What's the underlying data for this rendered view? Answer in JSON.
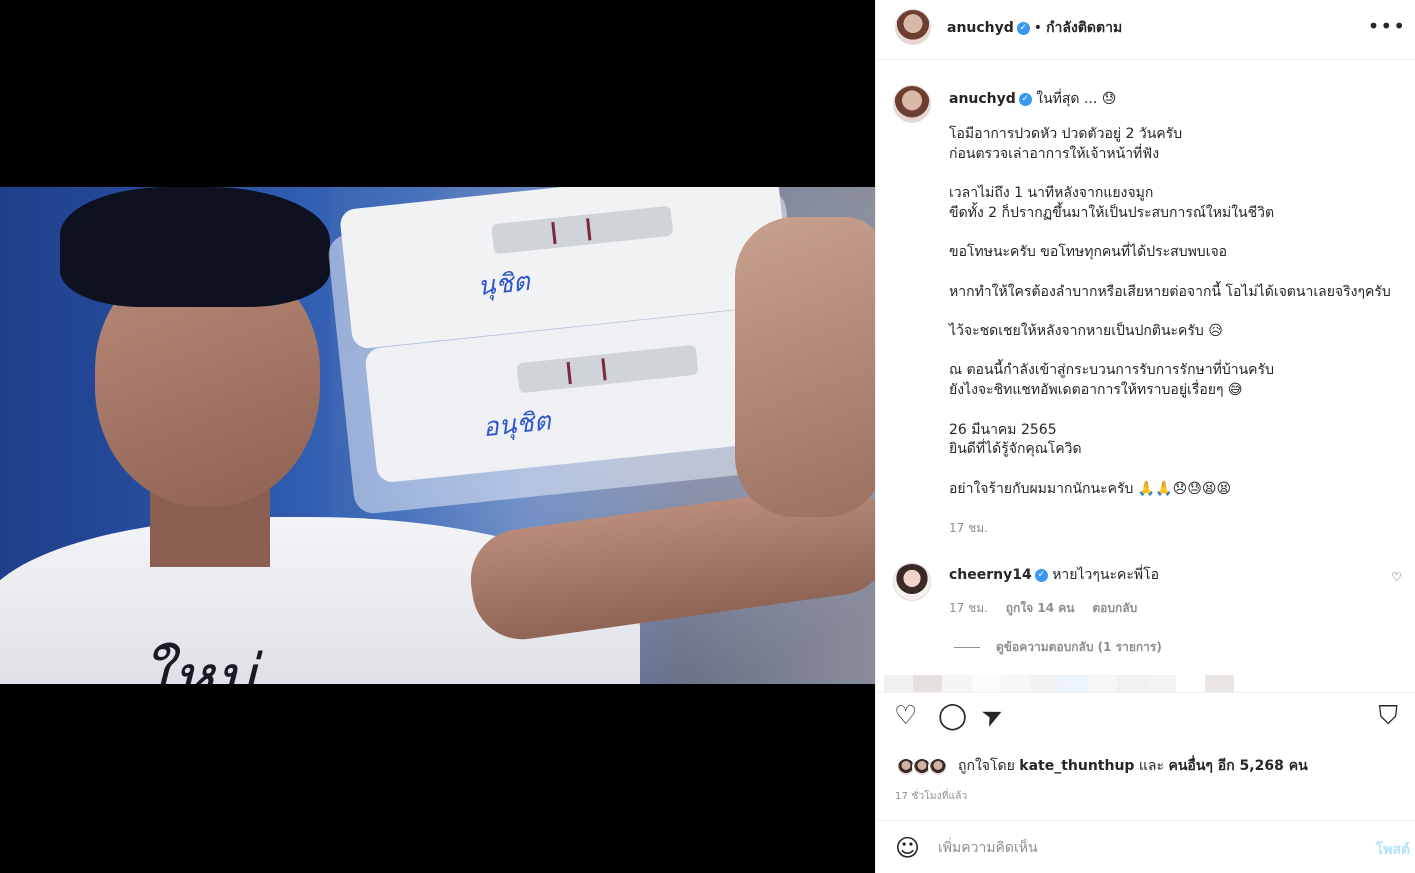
{
  "post": {
    "username": "anuchyd",
    "follow_status": "กำลังติดตาม",
    "verified_mark": "✓",
    "more_icon": "•••"
  },
  "caption": {
    "username": "anuchyd",
    "title": "ในที่สุด ... 😓",
    "body": "โอมีอาการปวดหัว ปวดตัวอยู่ 2 วันครับ\nก่อนตรวจเล่าอาการให้เจ้าหน้าที่ฟัง\n\nเวลาไม่ถึง 1 นาทีหลังจากแยงจมูก\nขีดทั้ง 2 ก็ปรากฏขึ้นมาให้เป็นประสบการณ์ใหม่ในชีวิต\n\nขอโทษนะครับ ขอโทษทุกคนที่ได้ประสบพบเจอ\n\nหากทำให้ใครต้องลำบากหรือเสียหายต่อจากนี้ โอไม่ได้เจตนาเลยจริงๆครับ\n\nไว้จะชดเชยให้หลังจากหายเป็นปกตินะครับ 😥\n\nณ ตอนนี้กำลังเข้าสู่กระบวนการรับการรักษาที่บ้านครับ\nยังไงจะชิทแชทอัพเดตอาการให้ทราบอยู่เรื่อยๆ 😅\n\n26 มีนาคม 2565\nยินดีที่ได้รู้จักคุณโควิด\n\nอย่าใจร้ายกับผมมากนักนะครับ 🙏🙏😞😓😫😫",
    "time": "17 ชม."
  },
  "comment": {
    "username": "cheerny14",
    "text": "หายไวๆนะคะพี่โอ",
    "time": "17 ชม.",
    "likes": "ถูกใจ 14 คน",
    "reply": "ตอบกลับ",
    "view_replies": "ดูข้อความตอบกลับ (1 รายการ)",
    "heart_icon": "♡"
  },
  "actions": {
    "like_icon": "♡",
    "comment_icon": "◯",
    "share_icon": "➤",
    "save_icon": "⛉"
  },
  "likes": {
    "prefix": "ถูกใจโดย",
    "user": "kate_thunthup",
    "and": "และ",
    "others": "คนอื่นๆ อีก 5,268 คน"
  },
  "timeago": "17 ชั่วโมงที่แล้ว",
  "add_comment": {
    "emoji_icon": "☺",
    "placeholder": "เพิ่มความคิดเห็น",
    "post_label": "โพสต์"
  },
  "photo": {
    "shirt_text": "ใหม่",
    "kit_text_1": "นุชิต",
    "kit_text_2": "อนุชิต"
  }
}
